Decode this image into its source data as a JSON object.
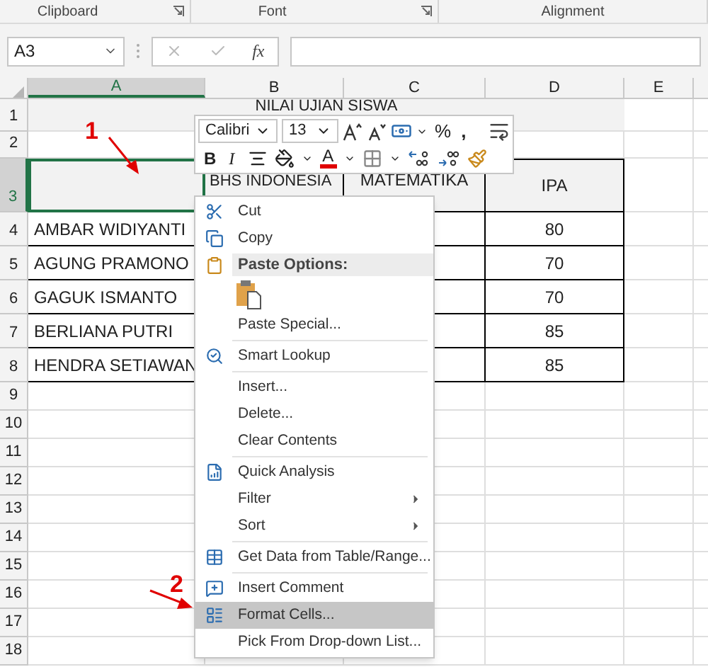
{
  "ribbon_groups": [
    {
      "label": "Clipboard",
      "launcher": true
    },
    {
      "label": "Font",
      "launcher": true
    },
    {
      "label": "Alignment",
      "launcher": false
    }
  ],
  "name_box": {
    "value": "A3"
  },
  "formula_bar": {
    "function_label": "fx"
  },
  "columns": [
    {
      "label": "A",
      "selected": true
    },
    {
      "label": "B",
      "selected": false
    },
    {
      "label": "C",
      "selected": false
    },
    {
      "label": "D",
      "selected": false
    },
    {
      "label": "E",
      "selected": false
    }
  ],
  "rows": [
    {
      "label": "1",
      "selected": false
    },
    {
      "label": "2",
      "selected": false
    },
    {
      "label": "3",
      "selected": true
    },
    {
      "label": "4",
      "selected": false
    },
    {
      "label": "5",
      "selected": false
    },
    {
      "label": "6",
      "selected": false
    },
    {
      "label": "7",
      "selected": false
    },
    {
      "label": "8",
      "selected": false
    },
    {
      "label": "9",
      "selected": false
    },
    {
      "label": "10",
      "selected": false
    },
    {
      "label": "11",
      "selected": false
    },
    {
      "label": "12",
      "selected": false
    },
    {
      "label": "13",
      "selected": false
    },
    {
      "label": "14",
      "selected": false
    },
    {
      "label": "15",
      "selected": false
    },
    {
      "label": "16",
      "selected": false
    },
    {
      "label": "17",
      "selected": false
    },
    {
      "label": "18",
      "selected": false
    }
  ],
  "sheet": {
    "title": "NILAI UJIAN SISWA",
    "headers": [
      "BHS INDONESIA",
      "MATEMATIKA",
      "IPA"
    ],
    "students": [
      {
        "name": "AMBAR WIDIYANTI",
        "ipa": "80"
      },
      {
        "name": "AGUNG PRAMONO",
        "ipa": "70"
      },
      {
        "name": "GAGUK ISMANTO",
        "ipa": "70"
      },
      {
        "name": "BERLIANA PUTRI",
        "ipa": "85"
      },
      {
        "name": "HENDRA SETIAWAN",
        "ipa": "85"
      }
    ]
  },
  "mini_toolbar": {
    "font": "Calibri",
    "size": "13",
    "percent": "%",
    "comma": ",",
    "bold": "B",
    "italic": "I",
    "font_color": "A"
  },
  "context_menu": [
    {
      "kind": "item",
      "label": "Cut",
      "selected": false
    },
    {
      "kind": "item",
      "label": "Copy",
      "selected": false
    },
    {
      "kind": "header",
      "label": "Paste Options:",
      "selected": false
    },
    {
      "kind": "paste",
      "selected": false
    },
    {
      "kind": "item",
      "label": "Paste Special...",
      "selected": false
    },
    {
      "kind": "separator"
    },
    {
      "kind": "item",
      "label": "Smart Lookup",
      "selected": false
    },
    {
      "kind": "separator"
    },
    {
      "kind": "item",
      "label": "Insert...",
      "selected": false
    },
    {
      "kind": "item",
      "label": "Delete...",
      "selected": false
    },
    {
      "kind": "item",
      "label": "Clear Contents",
      "selected": false
    },
    {
      "kind": "separator"
    },
    {
      "kind": "item",
      "label": "Quick Analysis",
      "selected": false
    },
    {
      "kind": "submenu",
      "label": "Filter",
      "selected": false
    },
    {
      "kind": "submenu",
      "label": "Sort",
      "selected": false
    },
    {
      "kind": "separator"
    },
    {
      "kind": "item",
      "label": "Get Data from Table/Range...",
      "selected": false
    },
    {
      "kind": "separator"
    },
    {
      "kind": "item",
      "label": "Insert Comment",
      "selected": false
    },
    {
      "kind": "item",
      "label": "Format Cells...",
      "selected": true
    },
    {
      "kind": "item",
      "label": "Pick From Drop-down List...",
      "selected": false
    }
  ],
  "annotations": [
    {
      "label": "1"
    },
    {
      "label": "2"
    }
  ]
}
